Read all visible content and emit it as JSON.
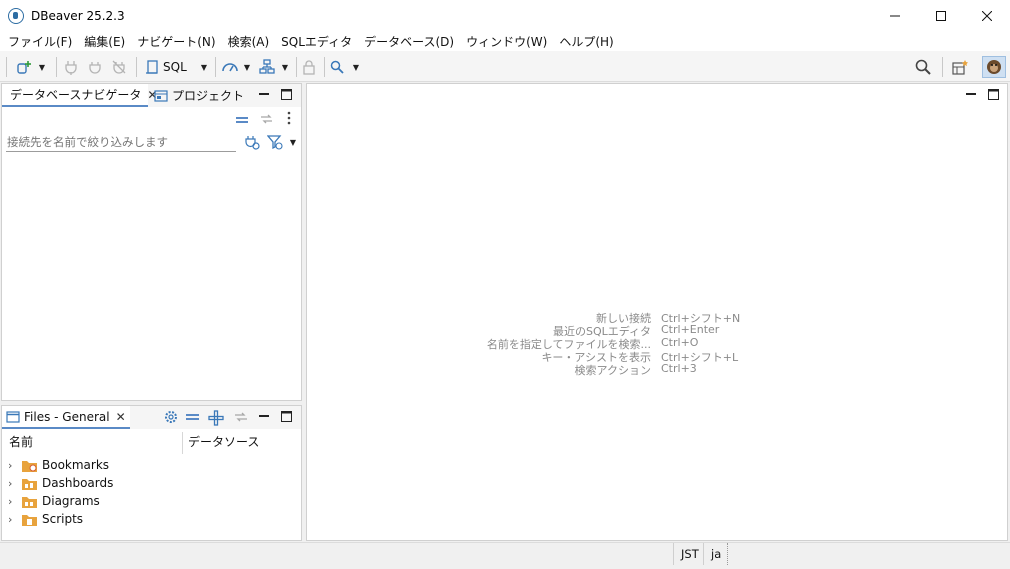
{
  "window": {
    "title": "DBeaver 25.2.3"
  },
  "menu": [
    "ファイル(F)",
    "編集(E)",
    "ナビゲート(N)",
    "検索(A)",
    "SQLエディタ",
    "データベース(D)",
    "ウィンドウ(W)",
    "ヘルプ(H)"
  ],
  "toolbar": {
    "sql_label": "SQL"
  },
  "navigator": {
    "tab_db": "データベースナビゲータ",
    "tab_project": "プロジェクト",
    "filter_placeholder": "接続先を名前で絞り込みします"
  },
  "files": {
    "tab": "Files - General",
    "col_name": "名前",
    "col_datasource": "データソース",
    "items": [
      "Bookmarks",
      "Dashboards",
      "Diagrams",
      "Scripts"
    ]
  },
  "hints": [
    {
      "label": "新しい接続",
      "key": "Ctrl+シフト+N"
    },
    {
      "label": "最近のSQLエディタ",
      "key": "Ctrl+Enter"
    },
    {
      "label": "名前を指定してファイルを検索...",
      "key": "Ctrl+O"
    },
    {
      "label": "キー・アシストを表示",
      "key": "Ctrl+シフト+L"
    },
    {
      "label": "検索アクション",
      "key": "Ctrl+3"
    }
  ],
  "status": {
    "timezone": "JST",
    "locale": "ja"
  },
  "colors": {
    "accent": "#5a8ac6",
    "folder": "#e8a33d",
    "icon_blue": "#3a78b8"
  }
}
